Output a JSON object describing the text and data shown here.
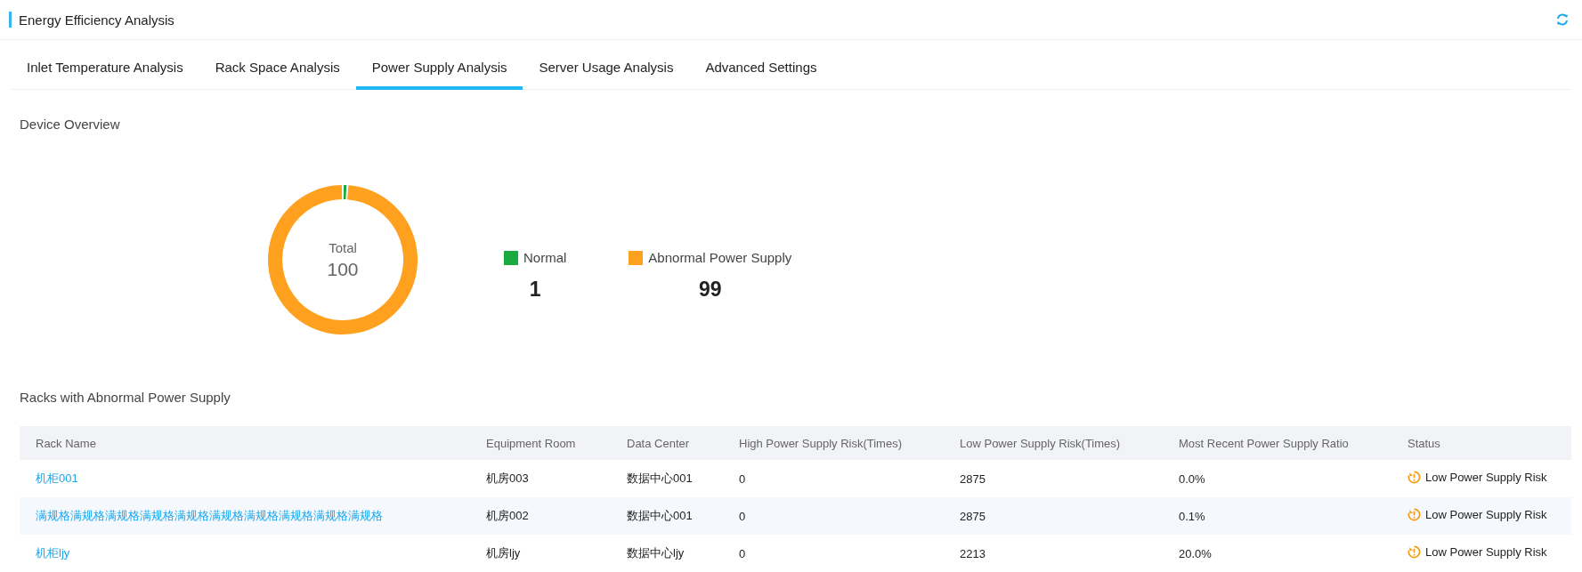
{
  "header": {
    "title": "Energy Efficiency Analysis"
  },
  "tabs": [
    {
      "label": "Inlet Temperature Analysis",
      "selected": false
    },
    {
      "label": "Rack Space Analysis",
      "selected": false
    },
    {
      "label": "Power Supply Analysis",
      "selected": true
    },
    {
      "label": "Server Usage Analysis",
      "selected": false
    },
    {
      "label": "Advanced Settings",
      "selected": false
    }
  ],
  "overview": {
    "title": "Device Overview",
    "center_label": "Total",
    "center_value": "100",
    "chart_data": {
      "type": "donut",
      "categories": [
        "Normal",
        "Abnormal Power Supply"
      ],
      "values": [
        1,
        99
      ]
    },
    "legend": [
      {
        "count": "1",
        "color": "#1aab40"
      },
      {
        "count": "99",
        "color": "#ffa01f"
      }
    ]
  },
  "racks": {
    "title": "Racks with Abnormal Power Supply",
    "columns": [
      "Rack Name",
      "Equipment Room",
      "Data Center",
      "High Power Supply Risk(Times)",
      "Low Power Supply Risk(Times)",
      "Most Recent Power Supply Ratio",
      "Status"
    ],
    "rows": [
      {
        "rack": "机柜001",
        "room": "机房003",
        "data_center": "数据中心001",
        "high": "0",
        "low": "2875",
        "ratio": "0.0%",
        "status": "Low Power Supply Risk"
      },
      {
        "rack": "满规格满规格满规格满规格满规格满规格满规格满规格满规格满规格",
        "room": "机房002",
        "data_center": "数据中心001",
        "high": "0",
        "low": "2875",
        "ratio": "0.1%",
        "status": "Low Power Supply Risk"
      },
      {
        "rack": "机柜ljy",
        "room": "机房ljy",
        "data_center": "数据中心ljy",
        "high": "0",
        "low": "2213",
        "ratio": "20.0%",
        "status": "Low Power Supply Risk"
      }
    ]
  }
}
